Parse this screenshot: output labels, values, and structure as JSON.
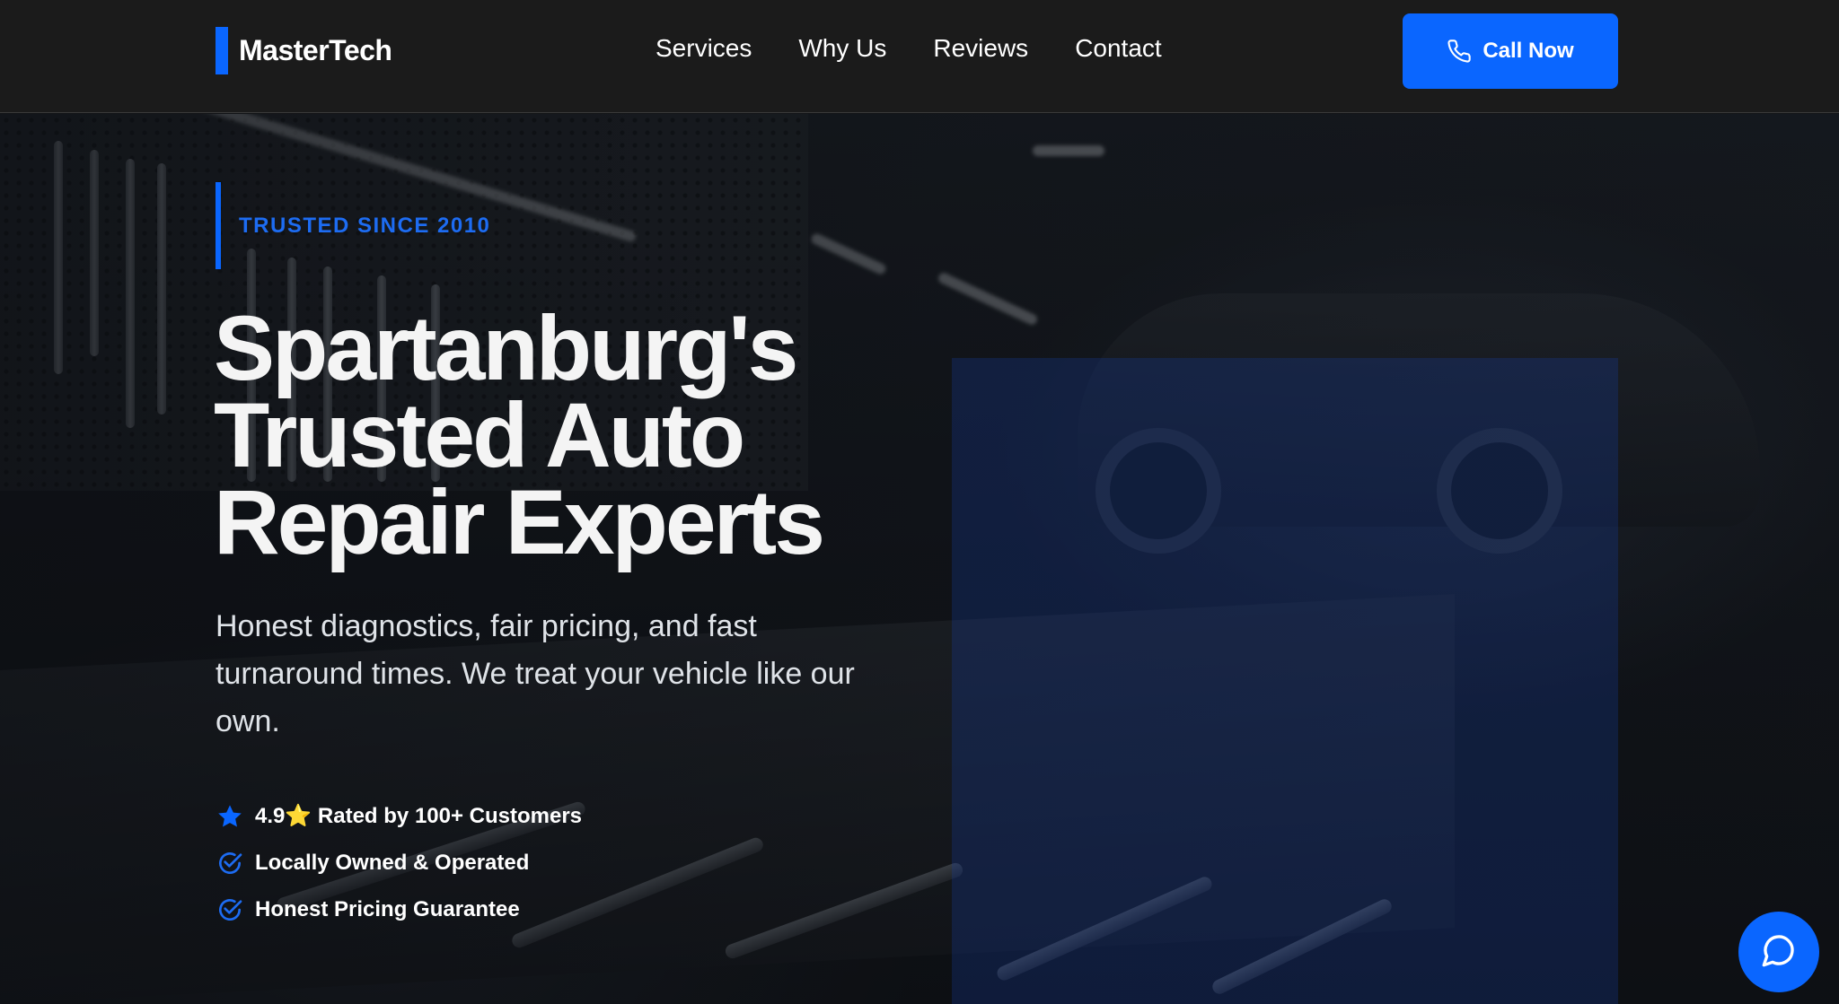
{
  "header": {
    "logo_text": "MasterTech",
    "nav": [
      {
        "label": "Services"
      },
      {
        "label": "Why Us"
      },
      {
        "label": "Reviews"
      },
      {
        "label": "Contact"
      }
    ],
    "cta_label": "Call Now"
  },
  "hero": {
    "eyebrow": "TRUSTED SINCE 2010",
    "headline": "Spartanburg's Trusted Auto Repair Experts",
    "subtext": "Honest diagnostics, fair pricing, and fast turnaround times. We treat your vehicle like our own.",
    "features": [
      {
        "icon": "star-icon",
        "text": "4.9⭐ Rated by 100+ Customers"
      },
      {
        "icon": "check-badge-icon",
        "text": "Locally Owned & Operated"
      },
      {
        "icon": "check-badge-icon",
        "text": "Honest Pricing Guarantee"
      }
    ]
  },
  "chat": {
    "icon": "chat-bubble-icon"
  },
  "colors": {
    "accent": "#0a66ff",
    "header_bg": "#1b1b1b"
  }
}
